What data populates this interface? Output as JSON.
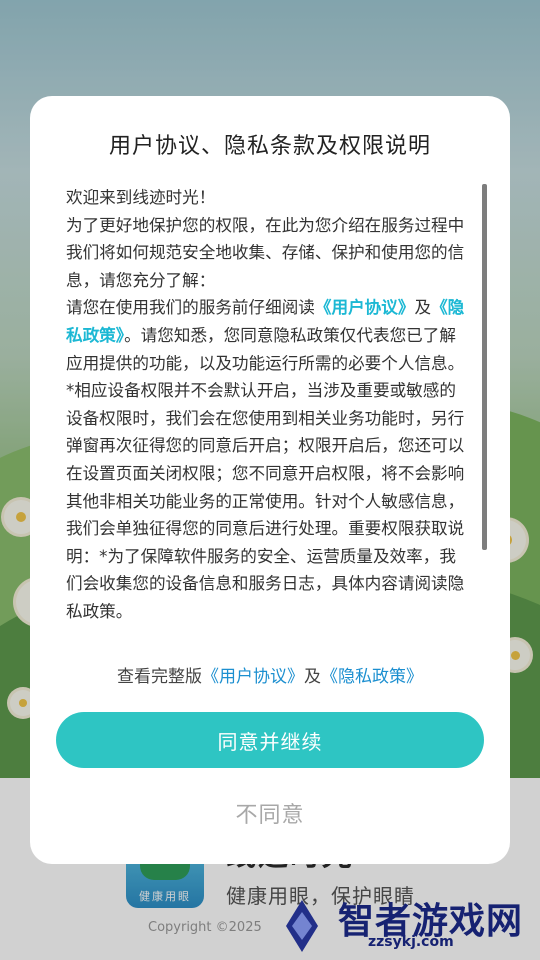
{
  "dialog": {
    "title": "用户协议、隐私条款及权限说明",
    "welcome": "欢迎来到线迹时光！",
    "intro": "为了更好地保护您的权限，在此为您介绍在服务过程中我们将如何规范安全地收集、存储、保护和使用您的信息，请您充分了解：",
    "read_prefix": "请您在使用我们的服务前仔细阅读",
    "user_agreement_link": "《用户协议》",
    "and": "及",
    "privacy_policy_link": "《隐私政策》",
    "read_suffix": "。请您知悉，您同意隐私政策仅代表您已了解应用提供的功能，以及功能运行所需的必要个人信息。",
    "permission_text": "*相应设备权限并不会默认开启，当涉及重要或敏感的设备权限时，我们会在您使用到相关业务功能时，另行弹窗再次征得您的同意后开启；权限开启后，您还可以在设置页面关闭权限；您不同意开启权限，将不会影响其他非相关功能业务的正常使用。针对个人敏感信息，我们会单独征得您的同意后进行处理。重要权限获取说明：*为了保障软件服务的安全、运营质量及效率，我们会收集您的设备信息和服务日志，具体内容请阅读隐私政策。",
    "full_prefix": "查看完整版",
    "full_user_agreement": "《用户协议》",
    "full_and": "及",
    "full_privacy_policy": "《隐私政策》",
    "agree_label": "同意并继续",
    "disagree_label": "不同意"
  },
  "background": {
    "app_name": "线迹时光",
    "app_logo_text": "健康用眼",
    "slogan": "健康用眼，保护眼睛",
    "copyright": "Copyright ©2025"
  },
  "watermark": {
    "title": "智者游戏网",
    "site": "zzsykj.com"
  },
  "colors": {
    "accent": "#2ec5c3",
    "link": "#1cb8d4"
  }
}
